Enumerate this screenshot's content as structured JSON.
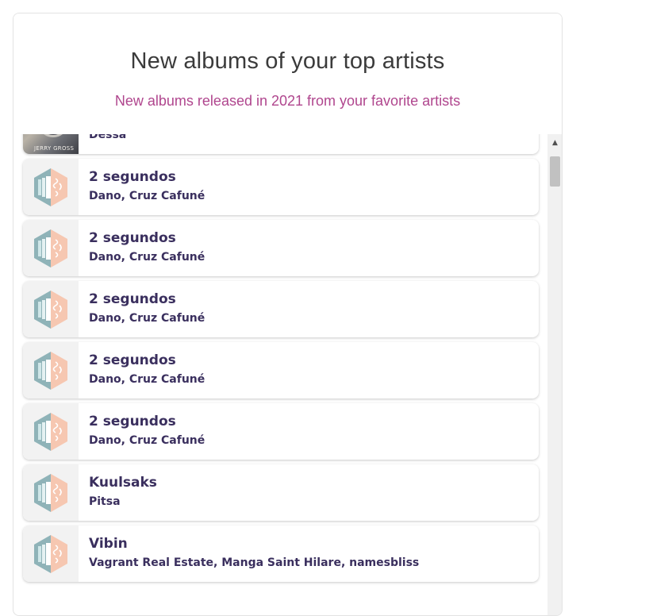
{
  "widget": {
    "title": "New albums of your top artists",
    "subtitle": "New albums released in 2021 from your favorite artists"
  },
  "albums": [
    {
      "name": "",
      "artists": "Dessa",
      "cover": "photo",
      "cover_text": "JERRY GROSS"
    },
    {
      "name": "2 segundos",
      "artists": "Dano, Cruz Cafuné",
      "cover": "placeholder-icon"
    },
    {
      "name": "2 segundos",
      "artists": "Dano, Cruz Cafuné",
      "cover": "placeholder-icon"
    },
    {
      "name": "2 segundos",
      "artists": "Dano, Cruz Cafuné",
      "cover": "placeholder-icon"
    },
    {
      "name": "2 segundos",
      "artists": "Dano, Cruz Cafuné",
      "cover": "placeholder-icon"
    },
    {
      "name": "2 segundos",
      "artists": "Dano, Cruz Cafuné",
      "cover": "placeholder-icon"
    },
    {
      "name": "Kuulsaks",
      "artists": "Pitsa",
      "cover": "placeholder-icon"
    },
    {
      "name": "Vibin",
      "artists": "Vagrant Real Estate, Manga Saint Hilare, namesbliss",
      "cover": "placeholder-icon"
    }
  ],
  "colors": {
    "title": "#3b3b3b",
    "subtitle": "#b0468e",
    "album_text": "#3a2f5e",
    "placeholder_teal": "#8fb3b8",
    "placeholder_peach": "#f6c7b1"
  }
}
